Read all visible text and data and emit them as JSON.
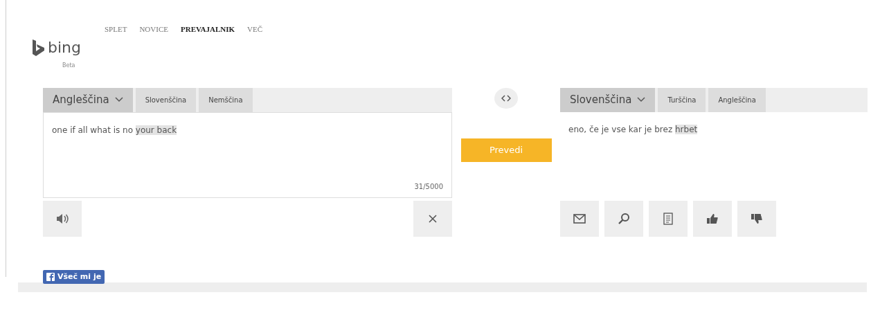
{
  "nav": [
    {
      "label": "SPLET",
      "selected": false
    },
    {
      "label": "NOVICE",
      "selected": false
    },
    {
      "label": "PREVAJALNIK",
      "selected": true
    },
    {
      "label": "VEČ",
      "selected": false
    }
  ],
  "logo": {
    "text": "bing",
    "subtitle": "Beta"
  },
  "source": {
    "tabs": [
      {
        "label": "Angleščina",
        "selected": true
      },
      {
        "label": "Slovenščina",
        "selected": false
      },
      {
        "label": "Nemščina",
        "selected": false
      }
    ],
    "text": [
      {
        "text": "one if all what is no ",
        "highlighted": false
      },
      {
        "text": "your back",
        "highlighted": true
      }
    ],
    "counter": "31/5000"
  },
  "translate_button": "Prevedi",
  "target": {
    "tabs": [
      {
        "label": "Slovenščina",
        "selected": true
      },
      {
        "label": "Turščina",
        "selected": false
      },
      {
        "label": "Angleščina",
        "selected": false
      }
    ],
    "text": [
      {
        "text": "eno, če je vse kar je brez ",
        "highlighted": false
      },
      {
        "text": "hrbet",
        "highlighted": true
      }
    ],
    "actions": [
      {
        "kind": "mail"
      },
      {
        "kind": "search"
      },
      {
        "kind": "document"
      },
      {
        "kind": "like"
      },
      {
        "kind": "dislike"
      }
    ]
  },
  "like_button": "Všeč mi je"
}
